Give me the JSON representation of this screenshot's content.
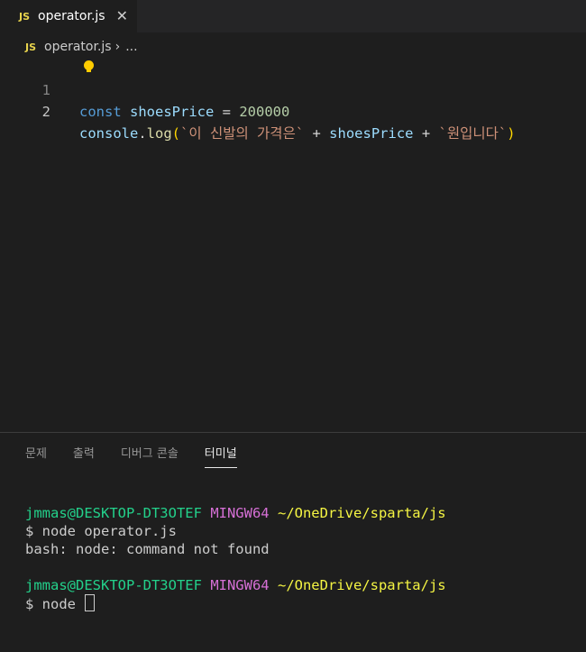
{
  "tab": {
    "lang_badge": "JS",
    "label": "operator.js",
    "close_glyph": "✕"
  },
  "breadcrumb": {
    "lang_badge": "JS",
    "file": "operator.js",
    "separator": "›",
    "more": "..."
  },
  "editor": {
    "line_numbers": [
      "1",
      "2"
    ],
    "line1": {
      "kw": "const",
      "space1": " ",
      "var": "shoesPrice",
      "op": " = ",
      "num": "200000"
    },
    "line2": {
      "obj": "console",
      "dot": ".",
      "fn": "log",
      "open": "(",
      "str1": "`이 신발의 가격은`",
      "plus1": " + ",
      "var": "shoesPrice",
      "plus2": " + ",
      "str2": "`원입니다`",
      "close": ")"
    }
  },
  "panel": {
    "tabs": [
      "문제",
      "출력",
      "디버그 콘솔",
      "터미널"
    ],
    "active_tab": "터미널"
  },
  "terminal": {
    "user_host": "jmmas@DESKTOP-DT3OTEF",
    "env": "MINGW64",
    "path": "~/OneDrive/sparta/js",
    "cmd1": "$ node operator.js",
    "err1": "bash: node: command not found",
    "cmd2": "$ node"
  },
  "colors": {
    "background": "#1e1e1e",
    "keyword": "#569cd6",
    "variable": "#9cdcfe",
    "number": "#b5cea8",
    "string": "#ce9178",
    "function": "#dcdcaa",
    "prompt_user": "#23d18b",
    "prompt_env": "#d670d6",
    "prompt_path": "#f5f543"
  }
}
